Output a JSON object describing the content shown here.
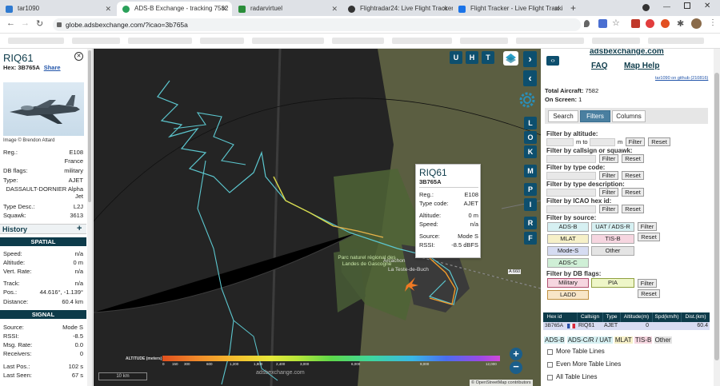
{
  "browser": {
    "tabs": [
      {
        "label": "tar1090",
        "color": "#2f7ad0"
      },
      {
        "label": "ADS-B Exchange - tracking 7582",
        "color": "#2aa05a"
      },
      {
        "label": "radarvirtuel",
        "color": "#2a8d3a"
      },
      {
        "label": "Flightradar24: Live Flight Tracker",
        "color": "#333333"
      },
      {
        "label": "Flight Tracker - Live Flight Tracki",
        "color": "#1a73e8"
      }
    ],
    "url": "globe.adsbexchange.com/?icao=3b765a"
  },
  "aircraft": {
    "callsign": "RIQ61",
    "hex_label": "Hex:",
    "hex": "3B765A",
    "share": "Share",
    "image_credit": "Image © Brendon Attard",
    "reg_label": "Reg.:",
    "reg": "E108",
    "country": "France",
    "dbflags_label": "DB flags:",
    "dbflags": "military",
    "type_label": "Type:",
    "type": "AJET",
    "model": "DASSAULT-DORNIER Alpha Jet",
    "typedesc_label": "Type Desc.:",
    "typedesc": "L2J",
    "squawk_label": "Squawk:",
    "squawk": "3613",
    "history": "History",
    "history_plus": "+",
    "spatial": "SPATIAL",
    "speed_label": "Speed:",
    "speed": "n/a",
    "alt_label": "Altitude:",
    "alt": "0 m",
    "vrate_label": "Vert. Rate:",
    "vrate": "n/a",
    "track_label": "Track:",
    "track": "n/a",
    "pos_label": "Pos.:",
    "pos": "44.616°, -1.139°",
    "dist_label": "Distance:",
    "dist": "60.4 km",
    "signal": "SIGNAL",
    "source_label": "Source:",
    "source": "Mode S",
    "rssi_label": "RSSI:",
    "rssi": "-8.5",
    "msgrate_label": "Msg. Rate:",
    "msgrate": "0.0",
    "recv_label": "Receivers:",
    "recv": "0",
    "lastpos_label": "Last Pos.:",
    "lastpos": "102 s",
    "lastseen_label": "Last Seen:",
    "lastseen": "67 s"
  },
  "popup": {
    "callsign": "RIQ61",
    "hex": "3B765A",
    "reg_label": "Reg.:",
    "reg": "E108",
    "type_label": "Type code:",
    "type": "AJET",
    "alt_label": "Altitude:",
    "alt": "0 m",
    "speed_label": "Speed:",
    "speed": "n/a",
    "source_label": "Source:",
    "source": "Mode S",
    "rssi_label": "RSSI:",
    "rssi": "-8.5 dBFS"
  },
  "map": {
    "buttons_top": [
      "U",
      "H",
      "T"
    ],
    "buttons_side": [
      "L",
      "O",
      "K",
      "M",
      "P",
      "I",
      "R",
      "F"
    ],
    "altitude_title": "ALTITUDE (meters)",
    "altitude_ticks": [
      "0",
      "150",
      "300",
      "600",
      "1,200",
      "1,800",
      "2,400",
      "3,000",
      "6,000",
      "9,000",
      "12,000"
    ],
    "scale": "10 km",
    "watermark": "adsbexchange.com",
    "attribution": "© OpenStreetMap contributors",
    "place_labels": [
      "Parc naturel régional des Landes de Gascogne",
      "Arcachon",
      "La Teste-de-Buch",
      "A 660"
    ]
  },
  "panel": {
    "site": "adsbexchange.com",
    "faq": "FAQ",
    "maphelp": "Map Help",
    "version": "tar1090 on github (210816)",
    "total_label": "Total Aircraft:",
    "total": "7582",
    "onscreen_label": "On Screen:",
    "onscreen": "1",
    "tabs": [
      "Search",
      "Filters",
      "Columns"
    ],
    "f_alt": "Filter by altitude:",
    "m_to": "m to",
    "m": "m",
    "filter": "Filter",
    "reset": "Reset",
    "f_call": "Filter by callsign or squawk:",
    "f_type": "Filter by type code:",
    "f_desc": "Filter by type description:",
    "f_icao": "Filter by ICAO hex id:",
    "f_src": "Filter by source:",
    "sources": [
      "ADS-B",
      "UAT / ADS-R",
      "MLAT",
      "TIS-B",
      "Mode-S",
      "Other",
      "ADS-C"
    ],
    "f_db": "Filter by DB flags:",
    "dbflags": [
      "Military",
      "PIA",
      "LADD"
    ],
    "table_headers": [
      "Hex id",
      "",
      "Callsign",
      "Type",
      "Altitude(m)",
      "Spd(km/h)",
      "Dist.(km)"
    ],
    "table_row": {
      "hex": "3B765A",
      "callsign": "RIQ61",
      "type": "AJET",
      "alt": "0",
      "spd": "",
      "dist": "60.4"
    },
    "legend": [
      "ADS-B",
      "ADS-C/R / UAT",
      "MLAT",
      "TIS-B",
      "Other"
    ],
    "more_lines": "More Table Lines",
    "even_more": "Even More Table Lines",
    "all_lines": "All Table Lines"
  }
}
